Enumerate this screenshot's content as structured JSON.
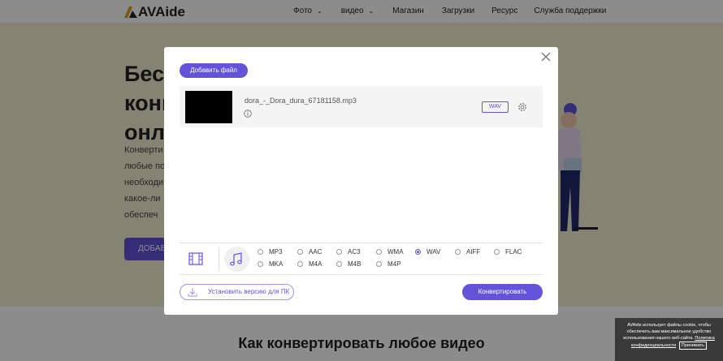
{
  "header": {
    "logo_text": "AVAide",
    "nav": [
      {
        "label": "Фото",
        "dropdown": true
      },
      {
        "label": "видео",
        "dropdown": true
      },
      {
        "label": "Магазин",
        "dropdown": false
      },
      {
        "label": "Загрузки",
        "dropdown": false
      },
      {
        "label": "Ресурс",
        "dropdown": false
      },
      {
        "label": "Служба поддержки",
        "dropdown": false
      }
    ]
  },
  "hero": {
    "title_lines": [
      "Бесп",
      "конв",
      "онла"
    ],
    "text_lines": [
      "Конверти",
      "любые по",
      "необходи",
      "какое-ли",
      "обеспеч"
    ],
    "button_label": "ДОБАВ"
  },
  "lower_title": "Как конвертировать любое видео",
  "modal": {
    "add_file_label": "Добавить файл",
    "file": {
      "name": "dora_-_Dora_dura_67181158.mp3",
      "output_format": "WAV"
    },
    "formats": [
      {
        "label": "MP3",
        "selected": false
      },
      {
        "label": "AAC",
        "selected": false
      },
      {
        "label": "AC3",
        "selected": false
      },
      {
        "label": "WMA",
        "selected": false
      },
      {
        "label": "WAV",
        "selected": true
      },
      {
        "label": "AIFF",
        "selected": false
      },
      {
        "label": "FLAC",
        "selected": false
      },
      {
        "label": "MKA",
        "selected": false
      },
      {
        "label": "M4A",
        "selected": false
      },
      {
        "label": "M4B",
        "selected": false
      },
      {
        "label": "M4P",
        "selected": false
      }
    ],
    "install_label": "Установить версию для ПК",
    "convert_label": "Конвертировать"
  },
  "cookie": {
    "text": "AVAide использует файлы cookie, чтобы обеспечить вам максимальное удобство использования нашего веб-сайта.",
    "policy_link": "Политика конфиденциальности",
    "accept_label": "Принимать"
  },
  "colors": {
    "accent": "#6353d8",
    "hero_bg": "#f3eed3"
  }
}
